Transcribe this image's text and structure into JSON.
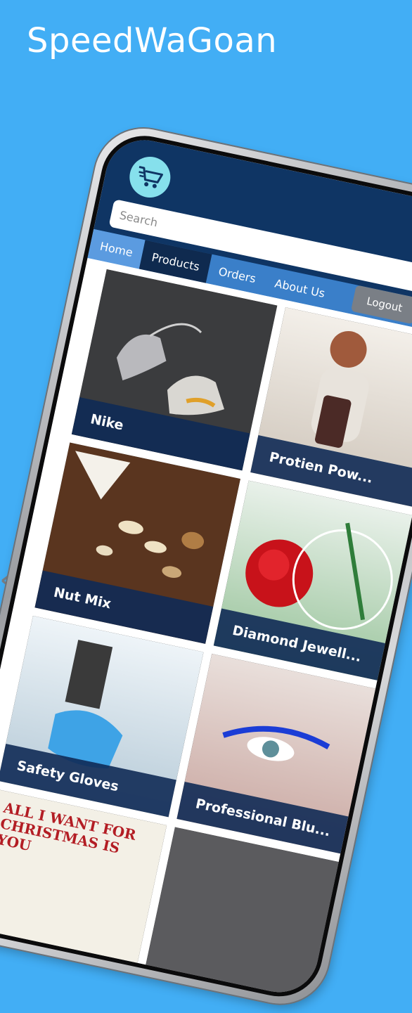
{
  "header": {
    "app_title": "SpeedWaGoan"
  },
  "search": {
    "placeholder": "Search"
  },
  "nav": {
    "tabs": [
      {
        "label": "Home"
      },
      {
        "label": "Products"
      },
      {
        "label": "Orders"
      },
      {
        "label": "About Us"
      }
    ],
    "logout_label": "Logout",
    "active_tab": "Products"
  },
  "products": [
    {
      "name": "Nike"
    },
    {
      "name": "Protien Pow..."
    },
    {
      "name": "Nut Mix"
    },
    {
      "name": "Diamond Jewell..."
    },
    {
      "name": "Safety Gloves"
    },
    {
      "name": "Professional Blu..."
    },
    {
      "name": ""
    },
    {
      "name": ""
    }
  ],
  "promo_image_text": "ALL I WANT FOR CHRISTMAS IS YOU",
  "colors": {
    "background": "#42aef5",
    "topbar": "#0f3564",
    "nav": "#3a7fc9",
    "active_tab": "#0f2a4f",
    "logo": "#86e0ec",
    "label_bg": "#0f2a55"
  },
  "icons": {
    "logo": "cart-icon",
    "prev": "chevron-left-icon",
    "next": "chevron-right-icon"
  }
}
